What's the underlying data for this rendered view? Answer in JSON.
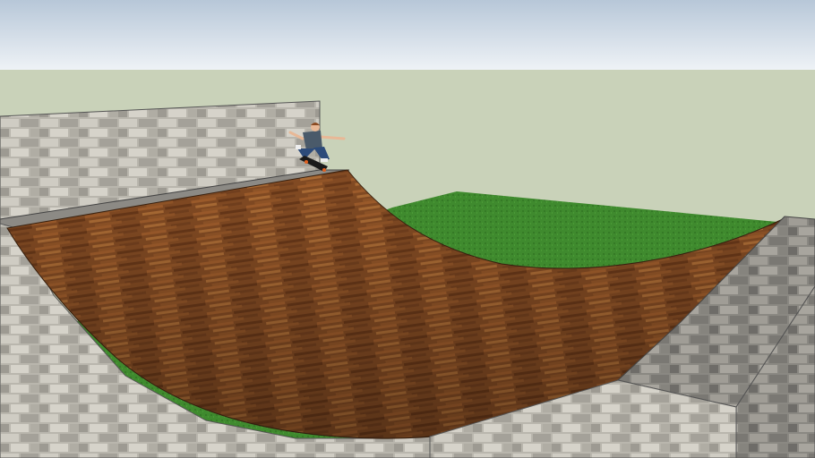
{
  "scene": {
    "description_label": "",
    "colors": {
      "sky_top": "#b8c8d8",
      "sky_bottom": "#e8eef4",
      "horizon_backdrop": "#c9d2b9",
      "grass": "#3f8a2e",
      "grass_dark": "#2f6e22",
      "stone_light": "#c9c6bd",
      "stone_mid": "#a9a69d",
      "stone_dark": "#7f7d78",
      "mortar": "#8e8b85",
      "wood_light": "#b0703a",
      "wood_mid": "#8a4f25",
      "wood_dark": "#5e3216",
      "skater_shirt": "#4a5a6a",
      "skater_pants": "#2c4b7a",
      "skater_skin": "#e8b896",
      "skater_hair": "#8a4a22",
      "board": "#1a1a1a",
      "wheels": "#e06020"
    },
    "objects": [
      "back-wall",
      "ramp-platform",
      "half-pipe-ramp",
      "right-platform",
      "front-wall",
      "skateboarder",
      "skateboard",
      "lawn"
    ]
  }
}
